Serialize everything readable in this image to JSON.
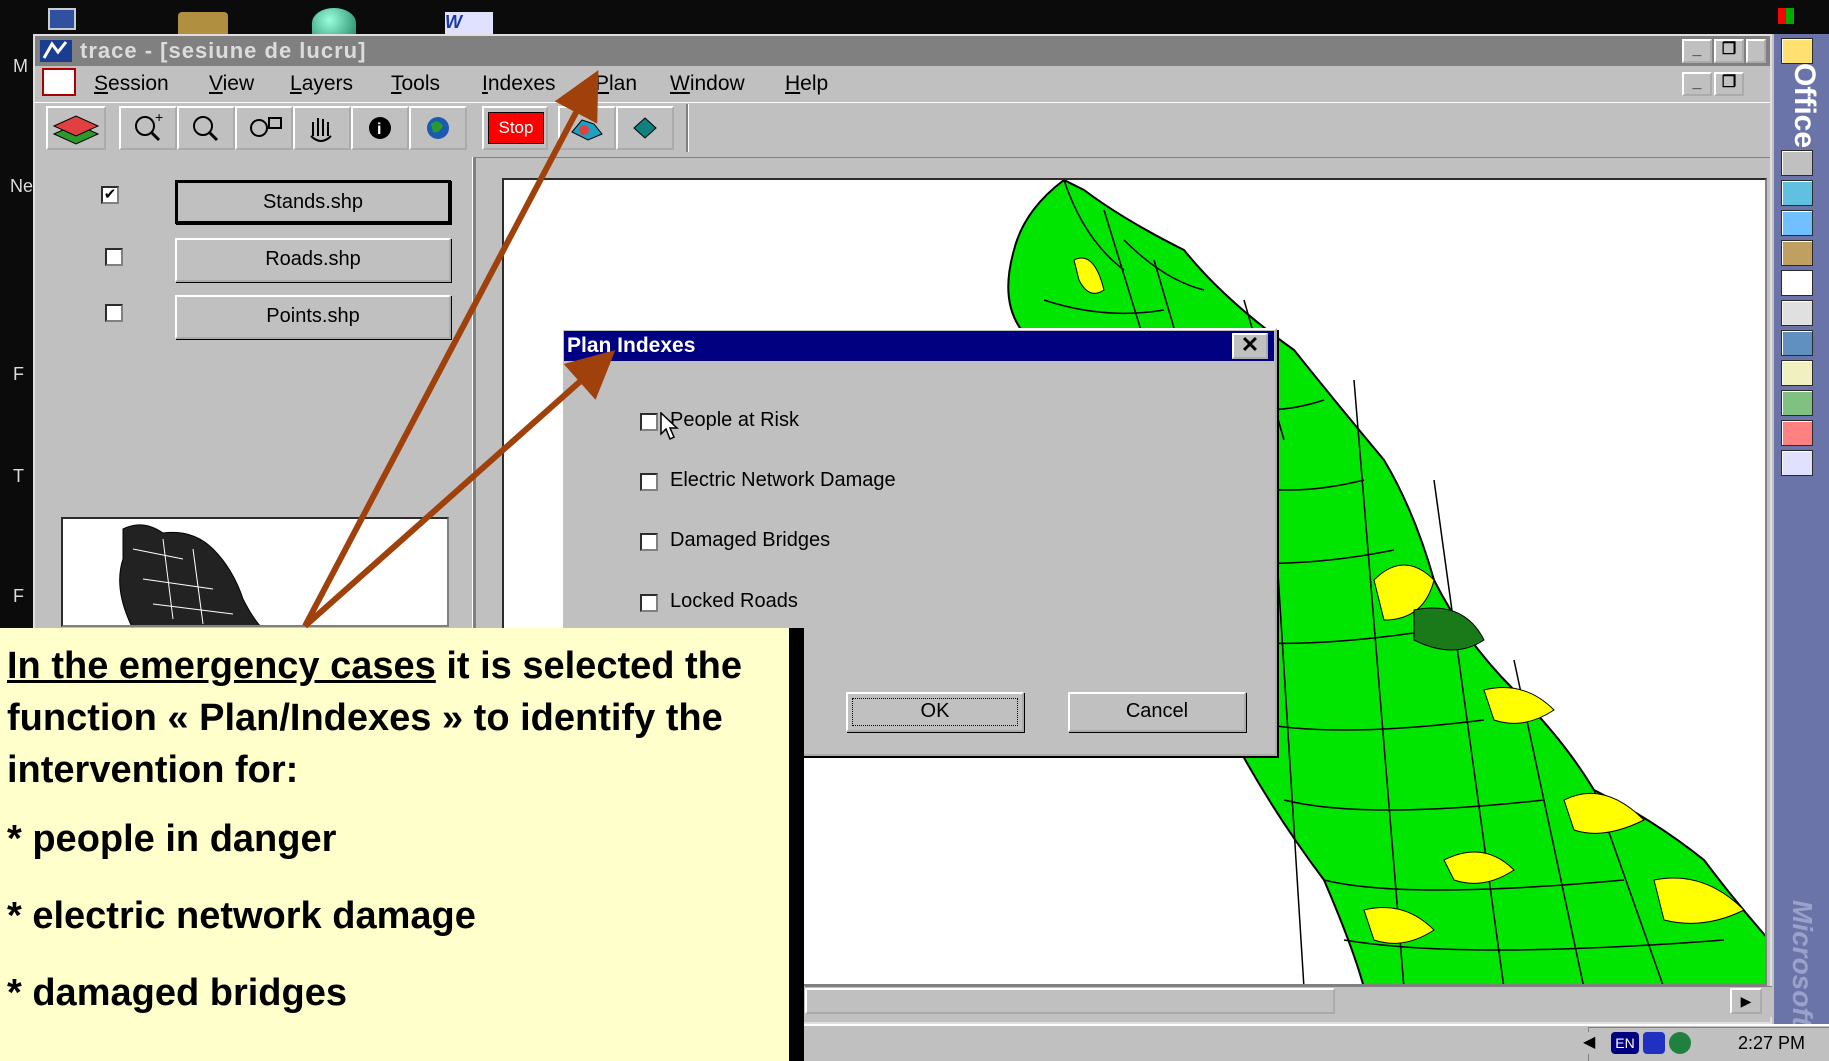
{
  "window": {
    "title": "trace - [sesiune de lucru]",
    "title_bar_color": "#808080"
  },
  "menu": {
    "items": [
      "Session",
      "View",
      "Layers",
      "Tools",
      "Indexes",
      "Plan",
      "Window",
      "Help"
    ]
  },
  "toolbar": {
    "stop_label": "Stop",
    "icons": [
      "layers-icon",
      "zoom-in-icon",
      "zoom-out-icon",
      "zoom-extent-icon",
      "pan-hand-icon",
      "info-icon",
      "globe-icon",
      "stop-icon",
      "map-shapes-icon",
      "diamond-icon"
    ]
  },
  "layers": [
    {
      "name": "Stands.shp",
      "checked": true
    },
    {
      "name": "Roads.shp",
      "checked": false
    },
    {
      "name": "Points.shp",
      "checked": false
    }
  ],
  "dialog": {
    "title": "Plan Indexes",
    "options": [
      "People at Risk",
      "Electric Network Damage",
      "Damaged Bridges",
      "Locked Roads"
    ],
    "ok_label": "OK",
    "cancel_label": "Cancel",
    "title_color": "#000080"
  },
  "annotation": {
    "underlined": "In the emergency cases",
    "rest": " it is selected the function « Plan/Indexes » to identify the intervention for:",
    "bullets": [
      "* people in danger",
      "* electric network damage",
      "* damaged bridges"
    ],
    "background": "#ffffcc",
    "arrow_color": "#a0400a"
  },
  "side_labels": [
    "M",
    "Ne",
    "F",
    "T",
    "F"
  ],
  "office_bar": {
    "title": "Office",
    "footer": "Microsoft",
    "icons": [
      "office-shortcut-icon",
      "screen-icon",
      "excel-icon",
      "word-icon",
      "access-icon",
      "document-icon",
      "presentation-icon",
      "contacts-icon",
      "tag-icon",
      "bird-icon",
      "network-icon",
      "cube-icon"
    ]
  },
  "tray": {
    "time": "2:27 PM",
    "language": "EN"
  },
  "map": {
    "green": "#00e600",
    "dark_green": "#1a7a1a",
    "yellow": "#ffff00"
  }
}
